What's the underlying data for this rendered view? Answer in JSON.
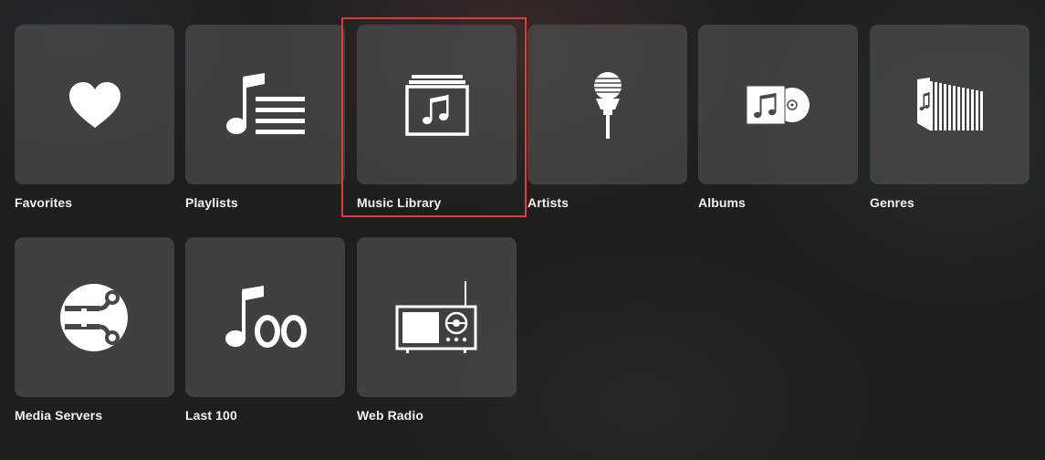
{
  "tiles": [
    {
      "label": "Favorites",
      "icon": "heart-icon"
    },
    {
      "label": "Playlists",
      "icon": "playlist-icon"
    },
    {
      "label": "Music Library",
      "icon": "music-library-icon"
    },
    {
      "label": "Artists",
      "icon": "microphone-icon"
    },
    {
      "label": "Albums",
      "icon": "album-icon"
    },
    {
      "label": "Genres",
      "icon": "genres-icon"
    },
    {
      "label": "Media Servers",
      "icon": "media-server-icon"
    },
    {
      "label": "Last 100",
      "icon": "last-100-icon"
    },
    {
      "label": "Web Radio",
      "icon": "radio-icon"
    }
  ],
  "highlighted_tile": "Music Library",
  "colors": {
    "background": "#1e1e1f",
    "tile": "#484848",
    "icon": "#ffffff",
    "label": "#f2f2f2",
    "highlight_border": "#e03a3a"
  }
}
